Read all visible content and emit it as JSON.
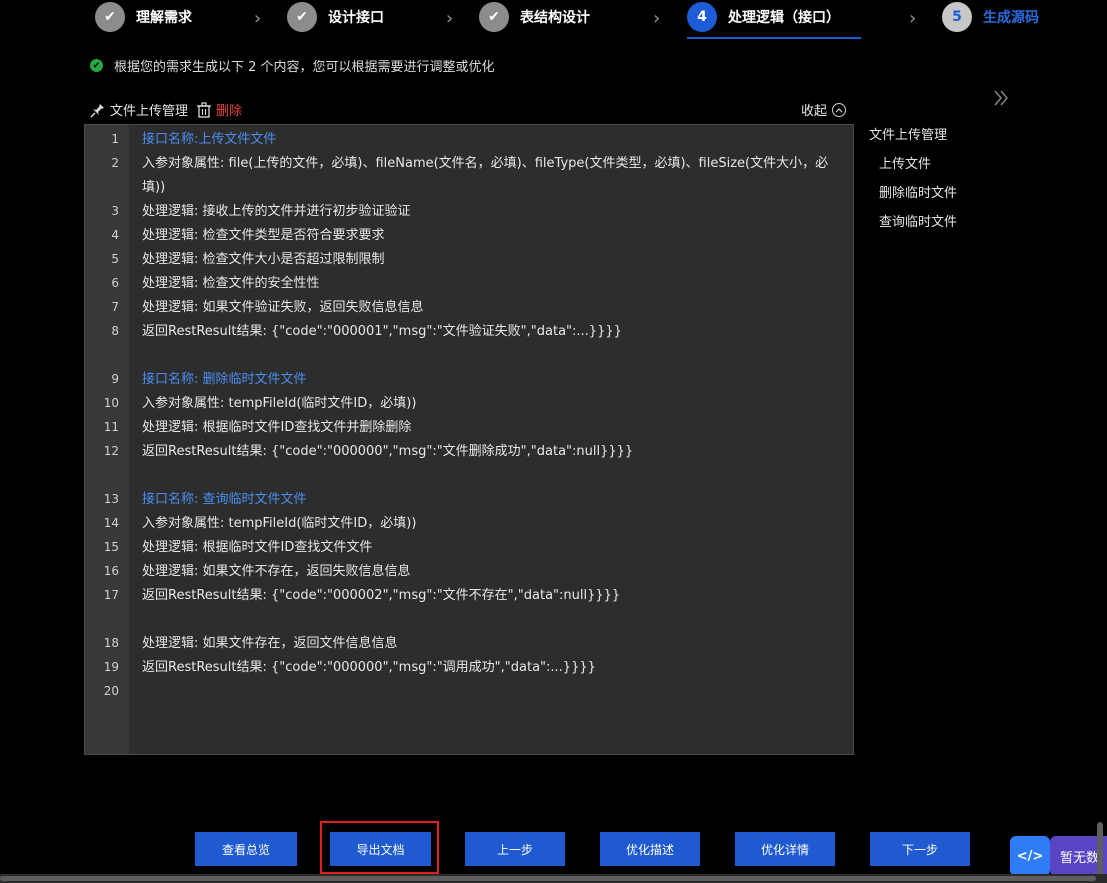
{
  "stepper": {
    "steps": [
      {
        "num": "✔",
        "label": "理解需求",
        "state": "done"
      },
      {
        "num": "✔",
        "label": "设计接口",
        "state": "done"
      },
      {
        "num": "✔",
        "label": "表结构设计",
        "state": "done"
      },
      {
        "num": "4",
        "label": "处理逻辑（接口）",
        "state": "active"
      },
      {
        "num": "5",
        "label": "生成源码",
        "state": "pending"
      }
    ],
    "separator": "›"
  },
  "notice": {
    "text": "根据您的需求生成以下 2 个内容，您可以根据需要进行调整或优化"
  },
  "toolbar": {
    "title": "文件上传管理",
    "delete_label": "删除",
    "collapse_label": "收起"
  },
  "editor": {
    "lines": [
      {
        "n": "1",
        "text": "接口名称:上传文件文件",
        "link": true
      },
      {
        "n": "2",
        "text": "入参对象属性: file(上传的文件，必填)、fileName(文件名，必填)、fileType(文件类型，必填)、fileSize(文件大小，必填))",
        "link": false
      },
      {
        "n": "3",
        "text": "处理逻辑: 接收上传的文件并进行初步验证验证",
        "link": false
      },
      {
        "n": "4",
        "text": "处理逻辑: 检查文件类型是否符合要求要求",
        "link": false
      },
      {
        "n": "5",
        "text": "处理逻辑: 检查文件大小是否超过限制限制",
        "link": false
      },
      {
        "n": "6",
        "text": "处理逻辑: 检查文件的安全性性",
        "link": false
      },
      {
        "n": "7",
        "text": "处理逻辑: 如果文件验证失败，返回失败信息信息",
        "link": false
      },
      {
        "n": "8",
        "text": "返回RestResult结果: {\"code\":\"000001\",\"msg\":\"文件验证失败\",\"data\":...}}}}",
        "link": false
      },
      {
        "n": "9",
        "text": "接口名称: 删除临时文件文件",
        "link": true
      },
      {
        "n": "10",
        "text": "入参对象属性: tempFileId(临时文件ID，必填))",
        "link": false
      },
      {
        "n": "11",
        "text": "处理逻辑: 根据临时文件ID查找文件并删除删除",
        "link": false
      },
      {
        "n": "12",
        "text": "返回RestResult结果: {\"code\":\"000000\",\"msg\":\"文件删除成功\",\"data\":null}}}}",
        "link": false
      },
      {
        "n": "13",
        "text": "接口名称: 查询临时文件文件",
        "link": true
      },
      {
        "n": "14",
        "text": "入参对象属性: tempFileId(临时文件ID，必填))",
        "link": false
      },
      {
        "n": "15",
        "text": "处理逻辑: 根据临时文件ID查找文件文件",
        "link": false
      },
      {
        "n": "16",
        "text": "处理逻辑: 如果文件不存在，返回失败信息信息",
        "link": false
      },
      {
        "n": "17",
        "text": "返回RestResult结果: {\"code\":\"000002\",\"msg\":\"文件不存在\",\"data\":null}}}}",
        "link": false
      },
      {
        "n": "18",
        "text": "处理逻辑: 如果文件存在，返回文件信息信息",
        "link": false
      },
      {
        "n": "19",
        "text": "返回RestResult结果: {\"code\":\"000000\",\"msg\":\"调用成功\",\"data\":...}}}}",
        "link": false
      },
      {
        "n": "20",
        "text": "",
        "link": false
      }
    ]
  },
  "outline": {
    "title": "文件上传管理",
    "items": [
      "上传文件",
      "删除临时文件",
      "查询临时文件"
    ]
  },
  "buttons": {
    "overview": "查看总览",
    "export": "导出文档",
    "prev": "上一步",
    "optimize_desc": "优化描述",
    "optimize_detail": "优化详情",
    "next": "下一步"
  },
  "widgets": {
    "code_icon": "</>",
    "no_data": "暂无数"
  },
  "colors": {
    "accent": "#1f5ad1",
    "link": "#4a8ff0",
    "danger": "#e8433a",
    "success": "#27a844"
  }
}
